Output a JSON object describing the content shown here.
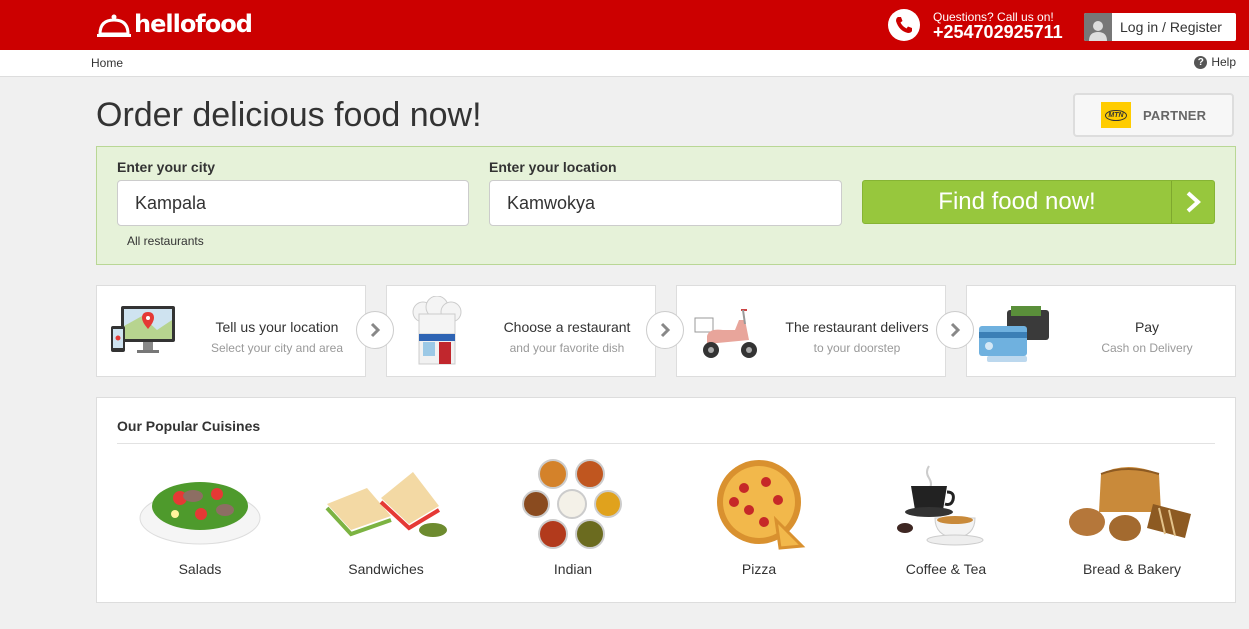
{
  "header": {
    "logo_text": "hellofood",
    "phone_question": "Questions? Call us on!",
    "phone_number": "+254702925711",
    "login_label": "Log in / Register"
  },
  "breadcrumb": {
    "home": "Home",
    "help": "Help"
  },
  "headline": "Order delicious food now!",
  "partner": {
    "logo_text": "MTN",
    "label": "PARTNER"
  },
  "search": {
    "city_label": "Enter your city",
    "city_value": "Kampala",
    "location_label": "Enter your location",
    "location_value": "Kamwokya",
    "all_restaurants": "All restaurants",
    "find_label": "Find food now!"
  },
  "steps": [
    {
      "title": "Tell us your location",
      "subtitle": "Select your city and area",
      "icon": "devices-map-icon"
    },
    {
      "title": "Choose a restaurant",
      "subtitle": "and your favorite dish",
      "icon": "chef-hat-icon"
    },
    {
      "title": "The restaurant delivers",
      "subtitle": "to your doorstep",
      "icon": "scooter-icon"
    },
    {
      "title": "Pay",
      "subtitle": "Cash on Delivery",
      "icon": "wallet-card-icon"
    }
  ],
  "cuisines": {
    "title": "Our Popular Cuisines",
    "items": [
      {
        "label": "Salads"
      },
      {
        "label": "Sandwiches"
      },
      {
        "label": "Indian"
      },
      {
        "label": "Pizza"
      },
      {
        "label": "Coffee & Tea"
      },
      {
        "label": "Bread & Bakery"
      }
    ]
  },
  "colors": {
    "brand_red": "#cc0000",
    "accent_green": "#97c73d",
    "search_bg": "#e6f2d9"
  }
}
